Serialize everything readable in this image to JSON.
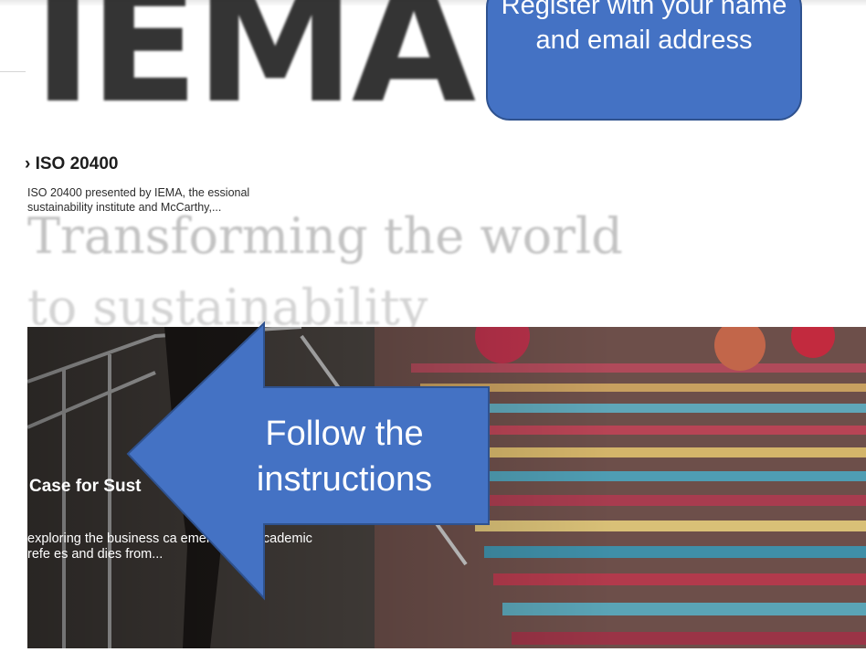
{
  "background": {
    "logo_text": "IEMA",
    "tagline_line1": "Transforming the world",
    "tagline_line2": "to sustainability"
  },
  "card_iso": {
    "title": "› ISO 20400",
    "description": "ISO 20400 presented by IEMA, the essional sustainability institute and McCarthy,..."
  },
  "card_case": {
    "title": "Case for Sust",
    "description": "exploring the business ca ement citing academic refe es and dies from..."
  },
  "callouts": {
    "register": "Register with your name and email address",
    "follow": "Follow the instructions"
  },
  "colors": {
    "callout_fill": "#4472c4",
    "callout_border": "#2f528f"
  }
}
